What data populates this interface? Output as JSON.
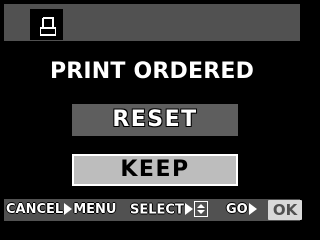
{
  "menu": {
    "heading": "PRINT ORDERED",
    "options": [
      {
        "label": "RESET",
        "selected": false
      },
      {
        "label": "KEEP",
        "selected": true
      }
    ]
  },
  "footer": {
    "cancel_label": "CANCEL",
    "menu_label": "MENU",
    "select_label": "SELECT",
    "go_label": "GO",
    "ok_label": "OK"
  },
  "icons": {
    "title": "print-icon",
    "arrow": "arrow-right-icon",
    "updown": "up-down-icon"
  },
  "colors": {
    "bar": "#515151",
    "option_bg": "#5e5e5e",
    "selected_bg": "#bdbdbd"
  }
}
